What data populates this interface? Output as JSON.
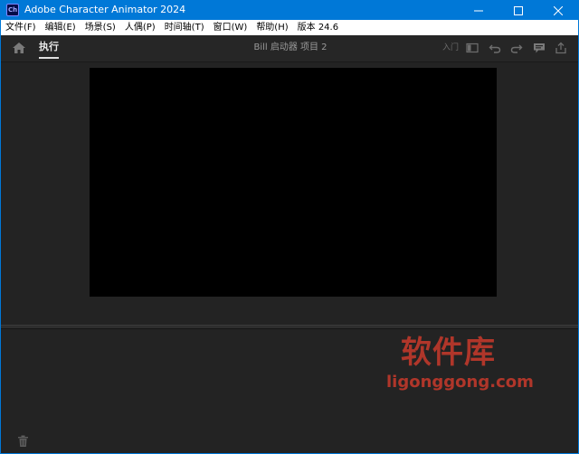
{
  "window": {
    "title": "Adobe Character Animator 2024",
    "logo_text": "Ch",
    "controls": [
      "minimize-icon",
      "maximize-icon",
      "close-icon"
    ]
  },
  "menubar": {
    "items": [
      "文件(F)",
      "编辑(E)",
      "场景(S)",
      "人偶(P)",
      "时间轴(T)",
      "窗口(W)",
      "帮助(H)",
      "版本 24.6"
    ]
  },
  "toolbar": {
    "home_icon": "home-icon",
    "mode_tab": "执行",
    "project_title": "Bill 启动器 项目 2",
    "input_label": "入门",
    "right_icons": [
      "panel-toggle-icon",
      "undo-icon",
      "redo-icon",
      "feedback-icon",
      "share-icon"
    ]
  },
  "workspace": {
    "canvas_color": "#000000"
  },
  "bottom_panel": {
    "trash_icon": "trash-icon"
  },
  "watermark": {
    "cn": "软件库",
    "en": "ligonggong.com",
    "color": "#c0392b"
  },
  "colors": {
    "titlebar": "#0078d7",
    "background": "#1e1e1e",
    "panel": "#262626"
  }
}
